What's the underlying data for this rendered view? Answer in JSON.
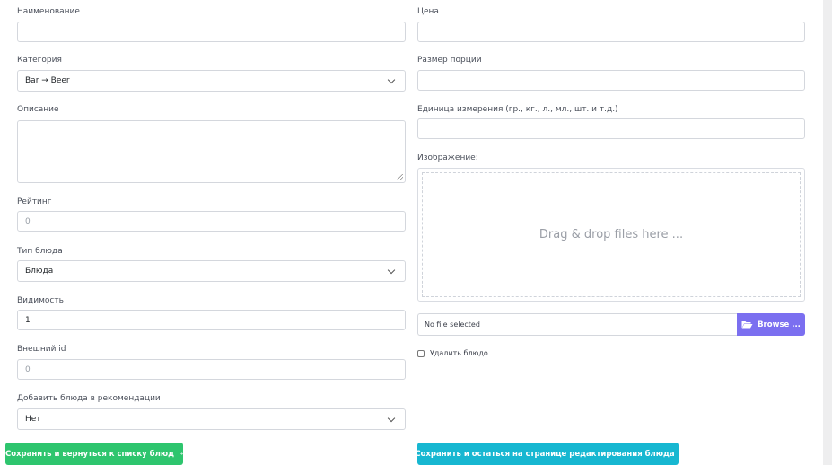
{
  "left": {
    "name": {
      "label": "Наименование",
      "value": ""
    },
    "category": {
      "label": "Категория",
      "value": "Bar → Beer"
    },
    "description": {
      "label": "Описание",
      "value": ""
    },
    "rating": {
      "label": "Рейтинг",
      "value": "0"
    },
    "dish_type": {
      "label": "Тип блюда",
      "value": "Блюда"
    },
    "visibility": {
      "label": "Видимость",
      "value": "1"
    },
    "external_id": {
      "label": "Внешний id",
      "value": "0"
    },
    "recommend": {
      "label": "Добавить блюда в рекомендации",
      "value": "Нет"
    }
  },
  "right": {
    "price": {
      "label": "Цена",
      "value": ""
    },
    "portion": {
      "label": "Размер порции",
      "value": ""
    },
    "unit": {
      "label": "Единица измерения (гр., кг., л., мл., шт. и т.д.)",
      "value": ""
    },
    "image": {
      "label": "Изображение:",
      "drop_text": "Drag & drop files here ...",
      "file_status": "No file selected",
      "browse_label": "Browse ..."
    },
    "delete": {
      "label": "Удалить блюдо",
      "checked": false
    }
  },
  "actions": {
    "save_back": "Сохранить и вернуться к списку блюд",
    "save_stay": "Сохранить и остаться на странице редактирования блюда"
  },
  "colors": {
    "browse": "#7b6ff0",
    "save_back": "#2ec56e",
    "save_stay": "#17b7d1"
  }
}
